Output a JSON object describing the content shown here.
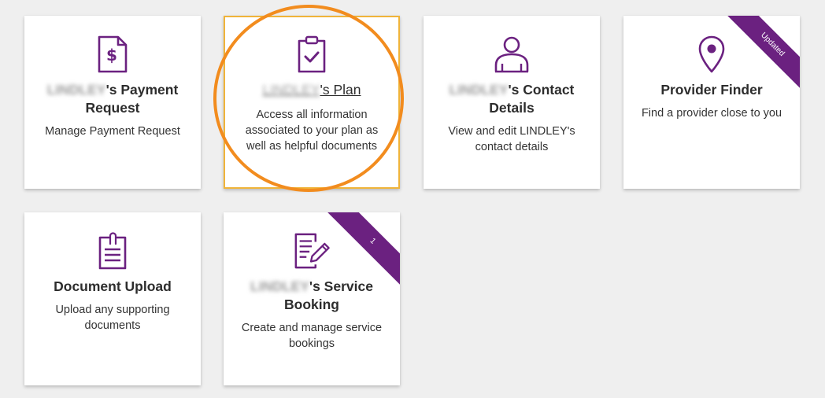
{
  "theme": {
    "accent": "#6b2180",
    "highlight": "#f28c1e",
    "selected_border": "#f0b43a"
  },
  "tiles": [
    {
      "icon": "dollar-document-icon",
      "title_name": "LINDLEY",
      "title_suffix": "'s Payment",
      "title_line2": "Request",
      "description": "Manage Payment Request"
    },
    {
      "icon": "clipboard-check-icon",
      "title_name": "LINDLEY",
      "title_suffix": "'s Plan",
      "description": "Access all information associated to your plan as well as helpful documents"
    },
    {
      "icon": "person-icon",
      "title_name": "LINDLEY",
      "title_suffix": "'s Contact",
      "title_line2": "Details",
      "description": "View and edit LINDLEY's contact details"
    },
    {
      "icon": "location-pin-icon",
      "title": "Provider Finder",
      "description": "Find a provider close to you",
      "ribbon": "Updated"
    },
    {
      "icon": "paperclip-document-icon",
      "title": "Document Upload",
      "description": "Upload any supporting documents"
    },
    {
      "icon": "document-edit-icon",
      "title_name": "LINDLEY",
      "title_suffix": "'s Service",
      "title_line2": "Booking",
      "description": "Create and manage service bookings",
      "ribbon": "1"
    }
  ]
}
